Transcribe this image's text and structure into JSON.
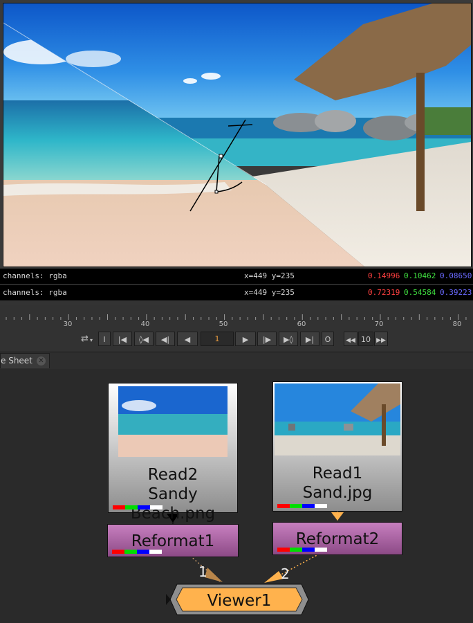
{
  "viewer": {
    "info_rows": [
      {
        "channels": "channels: rgba",
        "coords": "x=449 y=235",
        "r": "0.14996",
        "g": "0.10462",
        "b": "0.08650"
      },
      {
        "channels": "channels: rgba",
        "coords": "x=449 y=235",
        "r": "0.72319",
        "g": "0.54584",
        "b": "0.39223"
      }
    ]
  },
  "timeline": {
    "tick_labels": [
      "30",
      "40",
      "50",
      "60",
      "70",
      "80"
    ],
    "current_frame": "1",
    "in_label": "I",
    "out_label": "O",
    "increment": "10"
  },
  "tab": {
    "label": "e Sheet"
  },
  "nodes": {
    "read2": {
      "name": "Read2",
      "file": "Sandy Beach.png"
    },
    "read1": {
      "name": "Read1",
      "file": "Sand.jpg"
    },
    "reformat1": {
      "name": "Reformat1"
    },
    "reformat2": {
      "name": "Reformat2"
    },
    "viewer1": {
      "name": "Viewer1"
    },
    "input1": "1",
    "input2": "2"
  },
  "colors": {
    "red": "#ff0000",
    "green": "#00dd00",
    "blue": "#0000ff",
    "white": "#ffffff",
    "viewer_node": "#ffb24d",
    "reformat_node": "#a865a0"
  },
  "icons": [
    "loop-mode-icon",
    "go-to-start-icon",
    "prev-keyframe-icon",
    "step-back-icon",
    "play-backward-icon",
    "play-forward-icon",
    "step-forward-icon",
    "next-keyframe-icon",
    "go-to-end-icon",
    "step-increment-back-icon",
    "step-increment-forward-icon",
    "tab-close-icon"
  ]
}
